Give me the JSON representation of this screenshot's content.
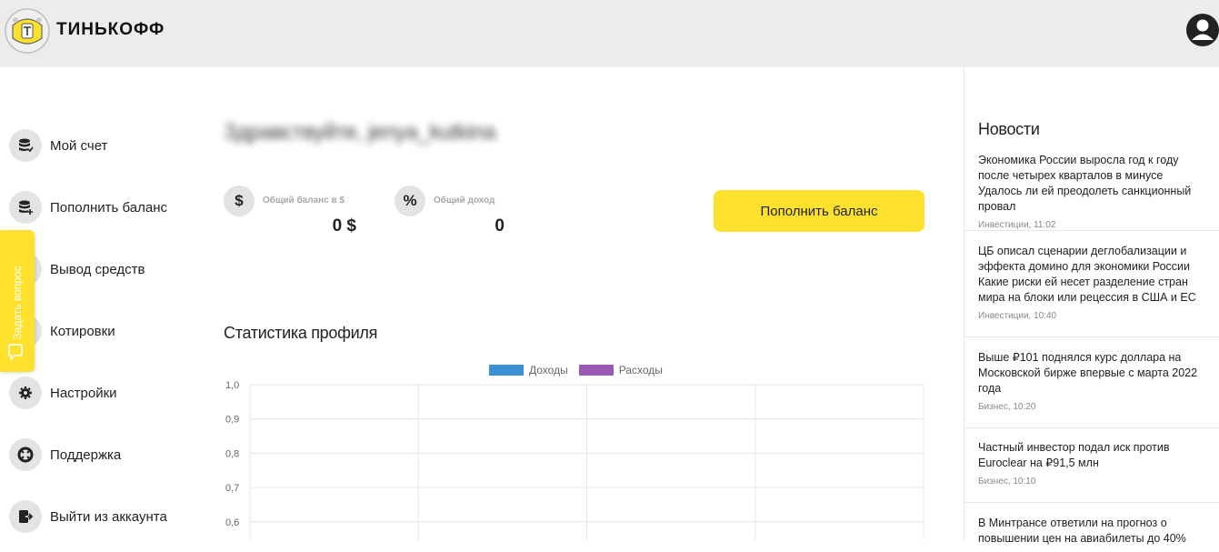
{
  "header": {
    "brand": "ТИНЬКОФФ",
    "logo_icon": "tinkoff-emblem-icon",
    "profile_icon": "user-avatar-icon"
  },
  "sidebar": {
    "items": [
      {
        "label": "Мой счет",
        "icon": "coins-check-icon"
      },
      {
        "label": "Пополнить баланс",
        "icon": "coins-plus-icon"
      },
      {
        "label": "Вывод средств",
        "icon": "withdraw-icon"
      },
      {
        "label": "Котировки",
        "icon": "quotes-icon"
      },
      {
        "label": "Настройки",
        "icon": "gear-icon"
      },
      {
        "label": "Поддержка",
        "icon": "lifebuoy-icon"
      },
      {
        "label": "Выйти из аккаунта",
        "icon": "logout-icon"
      }
    ]
  },
  "ask_tab": {
    "label": "Задать вопрос",
    "icon": "chat-bubble-icon"
  },
  "main": {
    "greeting": "Здравствуйте, jenya_kutkina",
    "balance": {
      "icon_glyph": "$",
      "label": "Общий баланс в $",
      "value": "0 $"
    },
    "income": {
      "icon_glyph": "%",
      "label": "Общий доход",
      "value": "0"
    },
    "topup_button": "Пополнить баланс",
    "stats_title": "Статистика профиля"
  },
  "chart_data": {
    "type": "line",
    "title": "",
    "series": [
      {
        "name": "Доходы",
        "color": "#3b8fd3",
        "values": []
      },
      {
        "name": "Расходы",
        "color": "#9b59b6",
        "values": []
      }
    ],
    "y_ticks": [
      "1,0",
      "0,9",
      "0,8",
      "0,7",
      "0,6"
    ],
    "ylim": [
      0,
      1
    ],
    "grid": true,
    "legend": "top-center",
    "vertical_gridlines": 4
  },
  "news": {
    "title": "Новости",
    "items": [
      {
        "headline": "Экономика России выросла год к году после четырех кварталов в минусе Удалось ли ей преодолеть санкционный провал",
        "meta": "Инвестиции, 11:02"
      },
      {
        "headline": "ЦБ описал сценарии деглобализации и эффекта домино для экономики России Какие риски ей несет разделение стран мира на блоки или рецессия в США и ЕС",
        "meta": "Инвестиции, 10:40"
      },
      {
        "headline": "Выше ₽101 поднялся курс доллара на Московской бирже впервые с марта 2022 года",
        "meta": "Бизнес, 10:20"
      },
      {
        "headline": "Частный инвестор подал иск против Euroclear на ₽91,5 млн",
        "meta": "Бизнес, 10:10"
      },
      {
        "headline": "В Минтрансе ответили на прогноз о повышении цен на авиабилеты до 40%",
        "meta": ""
      }
    ]
  }
}
